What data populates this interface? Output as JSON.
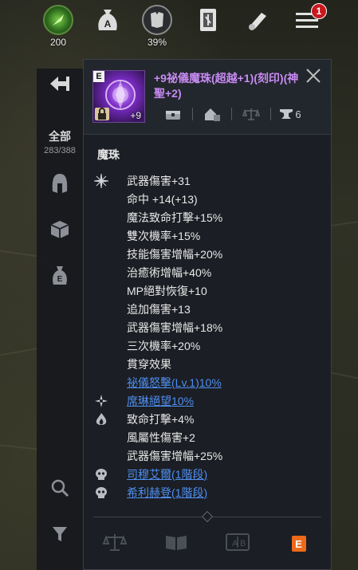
{
  "hud": {
    "gauge": {
      "value": "200",
      "icon": "green-spirit-icon"
    },
    "currency_a": {
      "icon": "money-bag-a-icon"
    },
    "armor": {
      "value": "39%",
      "icon": "armor-icon"
    },
    "cards": {
      "icon": "card-icon"
    },
    "scroll": {
      "icon": "scroll-icon"
    },
    "menu": {
      "icon": "menu-icon",
      "badge": "1"
    }
  },
  "sidebar": {
    "back_icon": "back-arrow-icon",
    "all_label": "全部",
    "all_count": "283/388",
    "items": [
      {
        "icon": "helmet-icon"
      },
      {
        "icon": "box-icon"
      },
      {
        "icon": "money-bag-e-icon"
      }
    ],
    "search_icon": "search-icon",
    "filter_icon": "filter-icon"
  },
  "item": {
    "grade": "E",
    "enhance": "+9",
    "name": "+9祕儀魔珠(超越+1)(刻印)(神聖+2)",
    "icons": [
      "chest-icon",
      "house-icon",
      "scale-icon",
      "anvil-icon"
    ],
    "trade_count": "6",
    "section_title": "魔珠",
    "stats": [
      {
        "icon": "spark-icon",
        "text": "武器傷害+31",
        "link": false
      },
      {
        "icon": "",
        "text": "命中 +14(+13)",
        "link": false
      },
      {
        "icon": "",
        "text": "魔法致命打擊+15%",
        "link": false
      },
      {
        "icon": "",
        "text": "雙次機率+15%",
        "link": false
      },
      {
        "icon": "",
        "text": "技能傷害增幅+20%",
        "link": false
      },
      {
        "icon": "",
        "text": "治癒術增幅+40%",
        "link": false
      },
      {
        "icon": "",
        "text": "MP絕對恢復+10",
        "link": false
      },
      {
        "icon": "",
        "text": "追加傷害+13",
        "link": false
      },
      {
        "icon": "",
        "text": "武器傷害增幅+18%",
        "link": false
      },
      {
        "icon": "",
        "text": "三次機率+20%",
        "link": false
      },
      {
        "icon": "",
        "text": "貫穿效果",
        "link": false
      },
      {
        "icon": "",
        "text": "祕儀怒擊(Lv.1)10%",
        "link": true
      },
      {
        "icon": "star-spark-icon",
        "text": "席琳絕望10%",
        "link": true
      },
      {
        "icon": "flame-icon",
        "text": "致命打擊+4%",
        "link": false
      },
      {
        "icon": "",
        "text": "風屬性傷害+2",
        "link": false
      },
      {
        "icon": "",
        "text": "武器傷害增幅+25%",
        "link": false
      },
      {
        "icon": "skull-icon",
        "text": "司穆艾爾(1階段)",
        "link": true
      },
      {
        "icon": "skull-icon",
        "text": "希利赫登(1階段)",
        "link": true
      }
    ],
    "actions": [
      "scale-icon",
      "book-icon",
      "ab-compare-icon",
      "e-button"
    ],
    "e_label": "E"
  },
  "colors": {
    "name": "#c78bf2",
    "link": "#4f8ff0",
    "badge": "#c8181e",
    "e_button": "#ec6a1a"
  }
}
